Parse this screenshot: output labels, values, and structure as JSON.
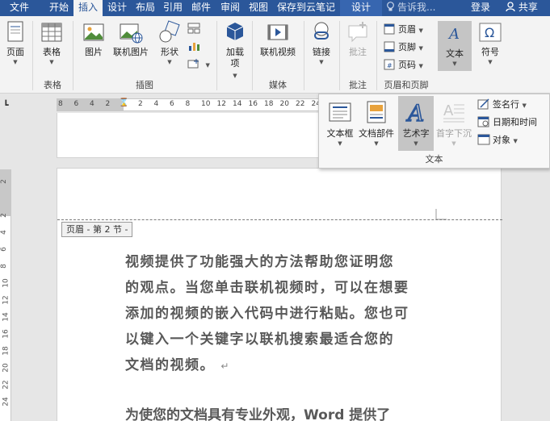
{
  "tabs": [
    "文件",
    "开始",
    "插入",
    "设计",
    "布局",
    "引用",
    "邮件",
    "审阅",
    "视图",
    "保存到云笔记",
    "设计"
  ],
  "active_tab": "插入",
  "tell_me": "告诉我...",
  "login": "登录",
  "share": "共享",
  "ribbon": {
    "pages": {
      "btn": "页面",
      "group": ""
    },
    "table": {
      "btn": "表格",
      "group": "表格"
    },
    "illustrations": {
      "picture": "图片",
      "online_picture": "联机图片",
      "shapes": "形状",
      "group": "插图"
    },
    "addins": {
      "btn1": "加载",
      "btn2": "项"
    },
    "media": {
      "online_video": "联机视频",
      "group": "媒体"
    },
    "links": {
      "btn": "链接"
    },
    "comments": {
      "btn": "批注",
      "group": "批注"
    },
    "header_footer": {
      "header": "页眉",
      "footer": "页脚",
      "page_number": "页码",
      "group": "页眉和页脚"
    },
    "text": {
      "btn": "文本"
    },
    "symbols": {
      "btn": "符号"
    }
  },
  "dropdown": {
    "textbox": "文本框",
    "quick_parts": "文档部件",
    "wordart": "艺术字",
    "dropcap": "首字下沉",
    "signature_line": "签名行",
    "date_time": "日期和时间",
    "object": "对象",
    "group": "文本"
  },
  "ruler": {
    "left": [
      "8",
      "6",
      "4",
      "2"
    ],
    "right": [
      "2",
      "4",
      "6",
      "8",
      "10",
      "12",
      "14",
      "16",
      "18",
      "20",
      "22",
      "24"
    ],
    "vertical": [
      "2",
      "2",
      "4",
      "6",
      "8",
      "10",
      "12",
      "14",
      "16",
      "18",
      "20",
      "22",
      "24"
    ]
  },
  "document": {
    "header_tag": "页眉 - 第 2 节 -",
    "para1_lines": [
      "视频提供了功能强大的方法帮助您证明您",
      "的观点。当您单击联机视频时，可以在想要",
      "添加的视频的嵌入代码中进行粘贴。您也可",
      "以键入一个关键字以联机搜索最适合您的",
      "文档的视频。"
    ],
    "para_mark": "↵",
    "para2_line": "为使您的文档具有专业外观，Word 提供了"
  },
  "colors": {
    "tabbar": "#2b579a",
    "ribbon": "#f3f3f3",
    "text": "#595959"
  }
}
